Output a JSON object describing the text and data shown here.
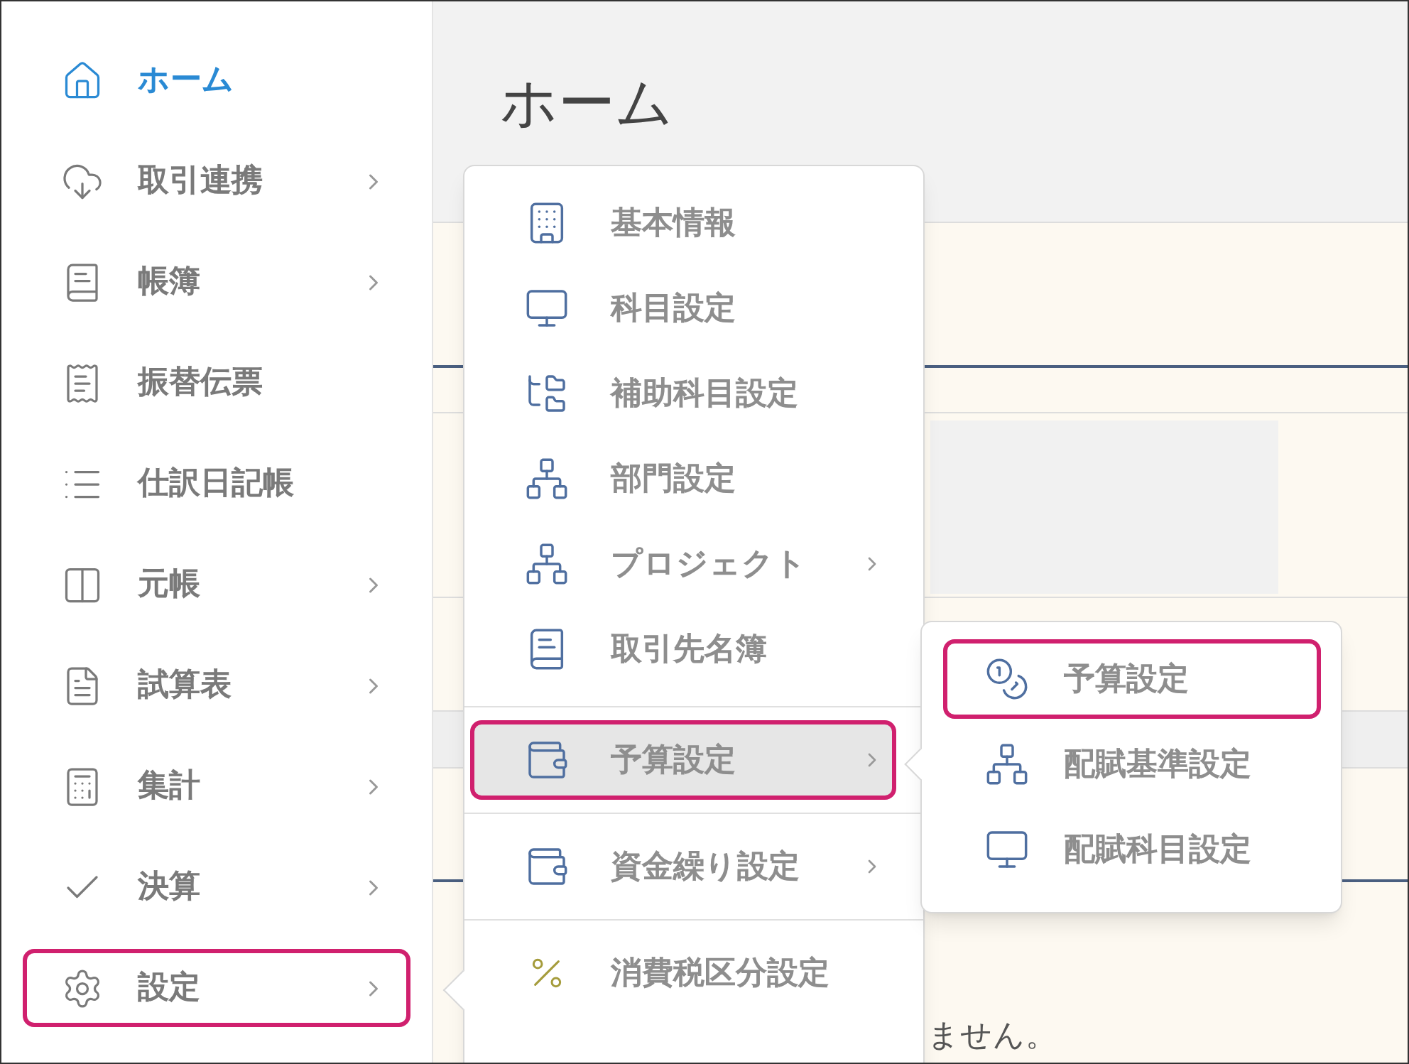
{
  "sidebar": {
    "items": [
      {
        "label": "ホーム",
        "selected": true,
        "has_submenu": false,
        "highlighted": false
      },
      {
        "label": "取引連携",
        "selected": false,
        "has_submenu": true,
        "highlighted": false
      },
      {
        "label": "帳簿",
        "selected": false,
        "has_submenu": true,
        "highlighted": false
      },
      {
        "label": "振替伝票",
        "selected": false,
        "has_submenu": false,
        "highlighted": false
      },
      {
        "label": "仕訳日記帳",
        "selected": false,
        "has_submenu": false,
        "highlighted": false
      },
      {
        "label": "元帳",
        "selected": false,
        "has_submenu": true,
        "highlighted": false
      },
      {
        "label": "試算表",
        "selected": false,
        "has_submenu": true,
        "highlighted": false
      },
      {
        "label": "集計",
        "selected": false,
        "has_submenu": true,
        "highlighted": false
      },
      {
        "label": "決算",
        "selected": false,
        "has_submenu": true,
        "highlighted": false
      },
      {
        "label": "設定",
        "selected": false,
        "has_submenu": true,
        "highlighted": true
      }
    ]
  },
  "page": {
    "title": "ホーム",
    "footer_text": "ません。"
  },
  "settings_menu": {
    "groups": [
      {
        "items": [
          {
            "label": "基本情報",
            "selected": false,
            "has_submenu": false,
            "highlighted": false
          },
          {
            "label": "科目設定",
            "selected": false,
            "has_submenu": false,
            "highlighted": false
          },
          {
            "label": "補助科目設定",
            "selected": false,
            "has_submenu": false,
            "highlighted": false
          },
          {
            "label": "部門設定",
            "selected": false,
            "has_submenu": false,
            "highlighted": false
          },
          {
            "label": "プロジェクト",
            "selected": false,
            "has_submenu": true,
            "highlighted": false
          },
          {
            "label": "取引先名簿",
            "selected": false,
            "has_submenu": false,
            "highlighted": false
          }
        ]
      },
      {
        "items": [
          {
            "label": "予算設定",
            "selected": true,
            "has_submenu": true,
            "highlighted": true
          }
        ]
      },
      {
        "items": [
          {
            "label": "資金繰り設定",
            "selected": false,
            "has_submenu": true,
            "highlighted": false
          }
        ]
      },
      {
        "items": [
          {
            "label": "消費税区分設定",
            "selected": false,
            "has_submenu": false,
            "highlighted": false
          }
        ]
      }
    ]
  },
  "budget_submenu": {
    "items": [
      {
        "label": "予算設定",
        "highlighted": true
      },
      {
        "label": "配賦基準設定",
        "highlighted": false
      },
      {
        "label": "配賦科目設定",
        "highlighted": false
      }
    ]
  }
}
